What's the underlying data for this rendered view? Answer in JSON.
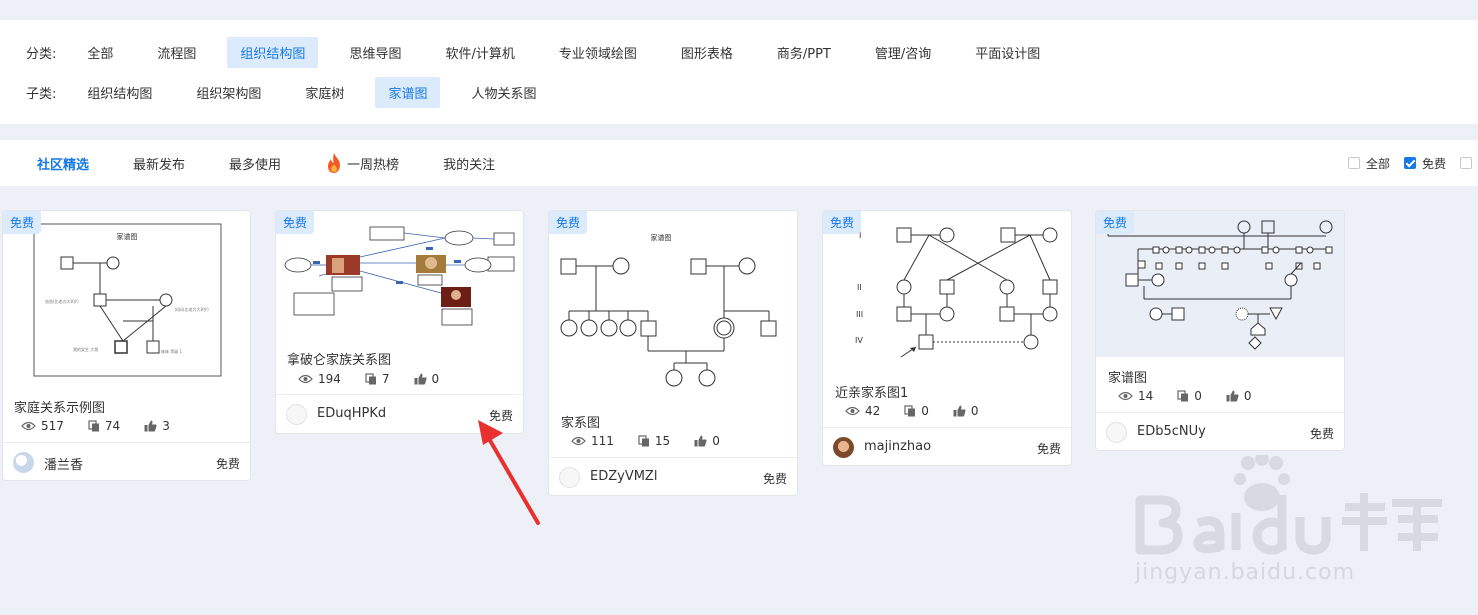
{
  "categories": {
    "label": "分类:",
    "items": [
      "全部",
      "流程图",
      "组织结构图",
      "思维导图",
      "软件/计算机",
      "专业领域绘图",
      "图形表格",
      "商务/PPT",
      "管理/咨询",
      "平面设计图"
    ],
    "active": "组织结构图"
  },
  "subcategories": {
    "label": "子类:",
    "items": [
      "组织结构图",
      "组织架构图",
      "家庭树",
      "家谱图",
      "人物关系图"
    ],
    "active": "家谱图"
  },
  "tabs": {
    "items": [
      "社区精选",
      "最新发布",
      "最多使用",
      "一周热榜",
      "我的关注"
    ],
    "active": "社区精选"
  },
  "filters": [
    {
      "label": "全部",
      "checked": false
    },
    {
      "label": "免费",
      "checked": true
    }
  ],
  "cards": [
    {
      "badge": "免费",
      "title": "家庭关系示例图",
      "views": "517",
      "copies": "74",
      "likes": "3",
      "author": "潘兰香",
      "price": "免费",
      "thumb_text": {
        "heading": "家谱图",
        "left_note": "爸爸(比老方大8岁)",
        "right_note": "妈妈(比老方大8岁)",
        "child_note_1": "我的女生 大我",
        "child_note_2": "妹妹 等级 1"
      }
    },
    {
      "badge": "免费",
      "title": "拿破仑家族关系图",
      "views": "194",
      "copies": "7",
      "likes": "0",
      "author": "EDuqHPKd",
      "price": "免费"
    },
    {
      "badge": "免费",
      "title": "家系图",
      "views": "111",
      "copies": "15",
      "likes": "0",
      "author": "EDZyVMZl",
      "price": "免费",
      "thumb_text": {
        "heading": "家谱图"
      }
    },
    {
      "badge": "免费",
      "title": "近亲家系图1",
      "views": "42",
      "copies": "0",
      "likes": "0",
      "author": "majinzhao",
      "price": "免费",
      "thumb_text": {
        "gen_labels": [
          "I",
          "II",
          "III",
          "IV"
        ]
      }
    },
    {
      "badge": "免费",
      "title": "家谱图",
      "views": "14",
      "copies": "0",
      "likes": "0",
      "author": "EDb5cNUy",
      "price": "免费"
    }
  ],
  "watermark": {
    "text": "jingyan.baidu.com"
  },
  "colors": {
    "accent": "#1677e6",
    "chip_bg": "#dcebfb",
    "page_bg": "#eef0f7",
    "arrow": "#e8302f"
  }
}
